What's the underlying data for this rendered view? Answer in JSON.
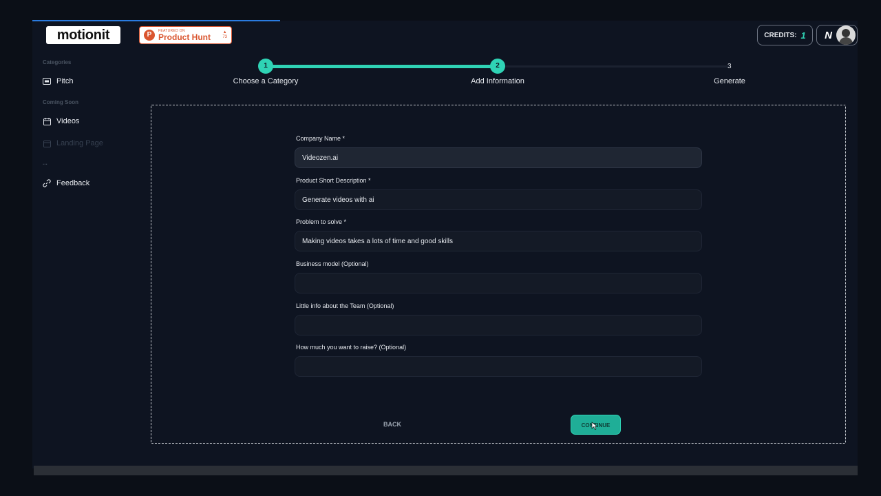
{
  "header": {
    "logo_text": "motionit",
    "product_hunt": {
      "small_text": "FEATURED ON",
      "big_text": "Product Hunt",
      "votes": "73"
    },
    "credits_label": "CREDITS:",
    "credits_value": "1",
    "user_initial": "N"
  },
  "sidebar": {
    "section_categories": "Categories",
    "pitch_label": "Pitch",
    "section_coming_soon": "Coming Soon",
    "videos_label": "Videos",
    "landing_label": "Landing Page",
    "dots": "...",
    "feedback_label": "Feedback"
  },
  "stepper": {
    "steps": [
      {
        "number": "1",
        "label": "Choose a Category"
      },
      {
        "number": "2",
        "label": "Add Information"
      },
      {
        "number": "3",
        "label": "Generate"
      }
    ]
  },
  "form": {
    "fields": [
      {
        "label": "Company Name *",
        "value": "Videozen.ai"
      },
      {
        "label": "Product Short Description *",
        "value": "Generate videos with ai"
      },
      {
        "label": "Problem to solve *",
        "value": "Making videos takes a lots of time and good skills"
      },
      {
        "label": "Business model (Optional)",
        "value": ""
      },
      {
        "label": "Little info about the Team (Optional)",
        "value": ""
      },
      {
        "label": "How much you want to raise? (Optional)",
        "value": ""
      }
    ],
    "back_label": "BACK",
    "continue_label": "CONTINUE"
  },
  "colors": {
    "accent": "#2fd3b5",
    "background": "#0e1421",
    "product_hunt": "#da552f"
  }
}
